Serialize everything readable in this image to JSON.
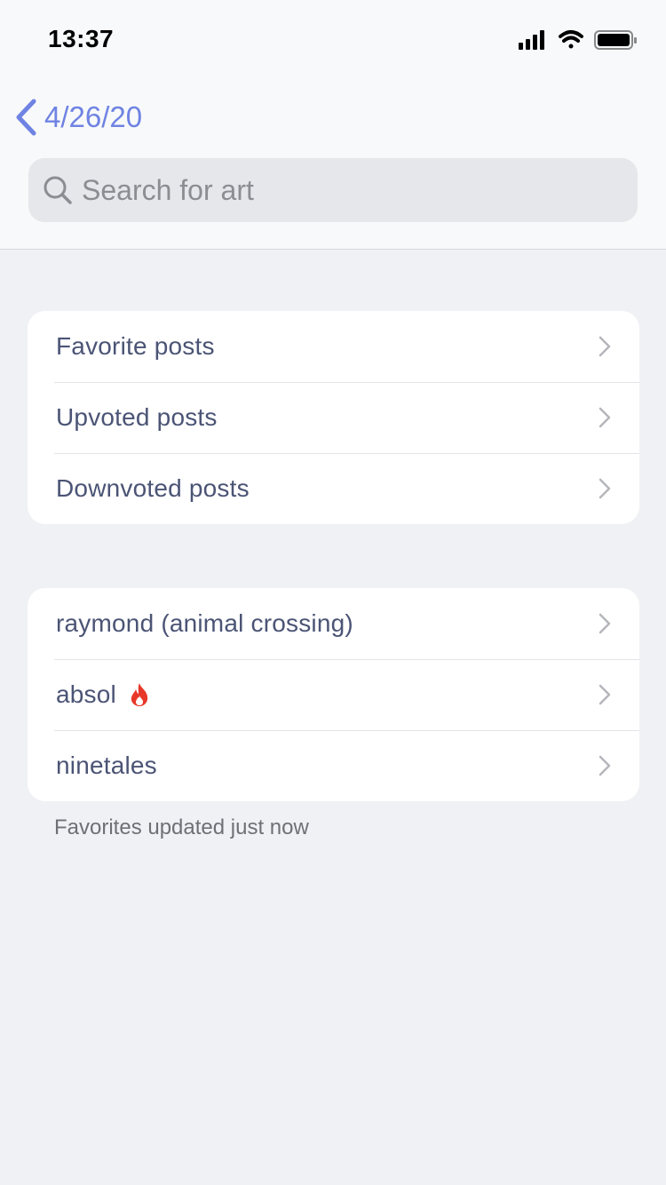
{
  "status_bar": {
    "time": "13:37"
  },
  "nav": {
    "back_label": "4/26/20"
  },
  "search": {
    "placeholder": "Search for art"
  },
  "group1": {
    "items": [
      {
        "label": "Favorite posts"
      },
      {
        "label": "Upvoted posts"
      },
      {
        "label": "Downvoted posts"
      }
    ]
  },
  "group2": {
    "items": [
      {
        "label": "raymond (animal crossing)"
      },
      {
        "label": "absol",
        "badge_icon": "flame-icon"
      },
      {
        "label": "ninetales"
      }
    ]
  },
  "footer": {
    "note": "Favorites updated just now"
  },
  "colors": {
    "accent": "#6f83e3",
    "row_text": "#4b5475",
    "flame": "#e8382a",
    "background": "#f0f1f4"
  }
}
